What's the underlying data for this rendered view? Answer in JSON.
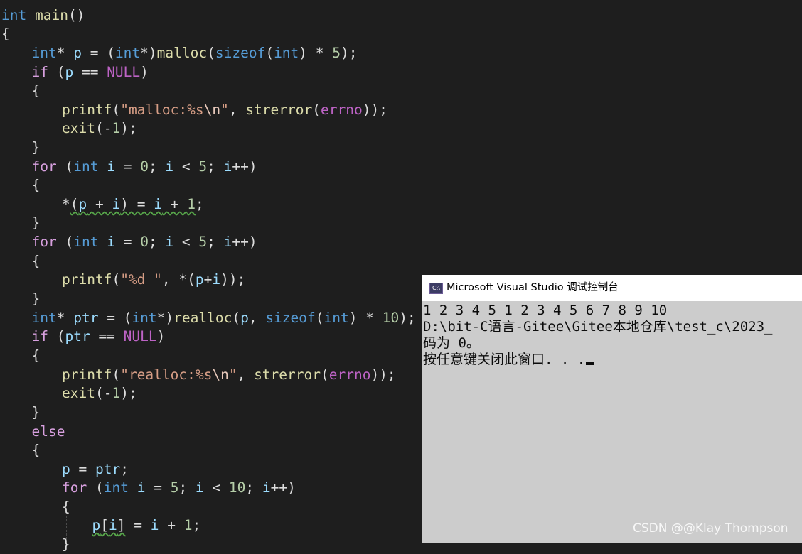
{
  "editor": {
    "lines": [
      {
        "tokens": [
          {
            "t": "int",
            "k": "kw"
          },
          {
            "t": " main",
            "k": "fn"
          },
          {
            "t": "()",
            "k": "plain"
          }
        ]
      },
      {
        "tokens": [
          {
            "t": "{",
            "k": "plain"
          }
        ]
      },
      {
        "tokens": [
          {
            "t": "int",
            "k": "kw"
          },
          {
            "t": "* ",
            "k": "plain"
          },
          {
            "t": "p",
            "k": "var"
          },
          {
            "t": " = (",
            "k": "plain"
          },
          {
            "t": "int",
            "k": "kw"
          },
          {
            "t": "*)",
            "k": "plain"
          },
          {
            "t": "malloc",
            "k": "fn"
          },
          {
            "t": "(",
            "k": "plain"
          },
          {
            "t": "sizeof",
            "k": "kw"
          },
          {
            "t": "(",
            "k": "plain"
          },
          {
            "t": "int",
            "k": "kw"
          },
          {
            "t": ") * ",
            "k": "plain"
          },
          {
            "t": "5",
            "k": "num"
          },
          {
            "t": ");",
            "k": "plain"
          }
        ]
      },
      {
        "tokens": [
          {
            "t": "if",
            "k": "ctl"
          },
          {
            "t": " (",
            "k": "plain"
          },
          {
            "t": "p",
            "k": "var"
          },
          {
            "t": " == ",
            "k": "plain"
          },
          {
            "t": "NULL",
            "k": "mac"
          },
          {
            "t": ")",
            "k": "plain"
          }
        ]
      },
      {
        "tokens": [
          {
            "t": "{",
            "k": "plain"
          }
        ]
      },
      {
        "tokens": [
          {
            "t": "printf",
            "k": "fn"
          },
          {
            "t": "(",
            "k": "plain"
          },
          {
            "t": "\"malloc:%s",
            "k": "str"
          },
          {
            "t": "\\n",
            "k": "esc"
          },
          {
            "t": "\"",
            "k": "str"
          },
          {
            "t": ", ",
            "k": "plain"
          },
          {
            "t": "strerror",
            "k": "fn"
          },
          {
            "t": "(",
            "k": "plain"
          },
          {
            "t": "errno",
            "k": "mac"
          },
          {
            "t": "));",
            "k": "plain"
          }
        ]
      },
      {
        "tokens": [
          {
            "t": "exit",
            "k": "fn"
          },
          {
            "t": "(-",
            "k": "plain"
          },
          {
            "t": "1",
            "k": "num"
          },
          {
            "t": ");",
            "k": "plain"
          }
        ]
      },
      {
        "tokens": [
          {
            "t": "}",
            "k": "plain"
          }
        ]
      },
      {
        "tokens": [
          {
            "t": "for",
            "k": "ctl"
          },
          {
            "t": " (",
            "k": "plain"
          },
          {
            "t": "int",
            "k": "kw"
          },
          {
            "t": " ",
            "k": "plain"
          },
          {
            "t": "i",
            "k": "var"
          },
          {
            "t": " = ",
            "k": "plain"
          },
          {
            "t": "0",
            "k": "num"
          },
          {
            "t": "; ",
            "k": "plain"
          },
          {
            "t": "i",
            "k": "var"
          },
          {
            "t": " < ",
            "k": "plain"
          },
          {
            "t": "5",
            "k": "num"
          },
          {
            "t": "; ",
            "k": "plain"
          },
          {
            "t": "i",
            "k": "var"
          },
          {
            "t": "++)",
            "k": "plain"
          }
        ]
      },
      {
        "tokens": [
          {
            "t": "{",
            "k": "plain"
          }
        ]
      },
      {
        "tokens": [
          {
            "t": "*",
            "k": "plain"
          },
          {
            "t": "(",
            "k": "plain",
            "w": 1
          },
          {
            "t": "p",
            "k": "var",
            "w": 1
          },
          {
            "t": " + ",
            "k": "plain",
            "w": 1
          },
          {
            "t": "i",
            "k": "var",
            "w": 1
          },
          {
            "t": ") = ",
            "k": "plain",
            "w": 1
          },
          {
            "t": "i",
            "k": "var",
            "w": 1
          },
          {
            "t": " + ",
            "k": "plain",
            "w": 1
          },
          {
            "t": "1",
            "k": "num",
            "w": 1
          },
          {
            "t": ";",
            "k": "plain"
          }
        ]
      },
      {
        "tokens": [
          {
            "t": "}",
            "k": "plain"
          }
        ]
      },
      {
        "tokens": [
          {
            "t": "for",
            "k": "ctl"
          },
          {
            "t": " (",
            "k": "plain"
          },
          {
            "t": "int",
            "k": "kw"
          },
          {
            "t": " ",
            "k": "plain"
          },
          {
            "t": "i",
            "k": "var"
          },
          {
            "t": " = ",
            "k": "plain"
          },
          {
            "t": "0",
            "k": "num"
          },
          {
            "t": "; ",
            "k": "plain"
          },
          {
            "t": "i",
            "k": "var"
          },
          {
            "t": " < ",
            "k": "plain"
          },
          {
            "t": "5",
            "k": "num"
          },
          {
            "t": "; ",
            "k": "plain"
          },
          {
            "t": "i",
            "k": "var"
          },
          {
            "t": "++)",
            "k": "plain"
          }
        ]
      },
      {
        "tokens": [
          {
            "t": "{",
            "k": "plain"
          }
        ]
      },
      {
        "tokens": [
          {
            "t": "printf",
            "k": "fn"
          },
          {
            "t": "(",
            "k": "plain"
          },
          {
            "t": "\"%d \"",
            "k": "str"
          },
          {
            "t": ", *(",
            "k": "plain"
          },
          {
            "t": "p",
            "k": "var"
          },
          {
            "t": "+",
            "k": "plain"
          },
          {
            "t": "i",
            "k": "var"
          },
          {
            "t": "));",
            "k": "plain"
          }
        ]
      },
      {
        "tokens": [
          {
            "t": "}",
            "k": "plain"
          }
        ]
      },
      {
        "tokens": [
          {
            "t": "int",
            "k": "kw"
          },
          {
            "t": "* ",
            "k": "plain"
          },
          {
            "t": "ptr",
            "k": "var"
          },
          {
            "t": " = (",
            "k": "plain"
          },
          {
            "t": "int",
            "k": "kw"
          },
          {
            "t": "*)",
            "k": "plain"
          },
          {
            "t": "realloc",
            "k": "fn"
          },
          {
            "t": "(",
            "k": "plain"
          },
          {
            "t": "p",
            "k": "var"
          },
          {
            "t": ", ",
            "k": "plain"
          },
          {
            "t": "sizeof",
            "k": "kw"
          },
          {
            "t": "(",
            "k": "plain"
          },
          {
            "t": "int",
            "k": "kw"
          },
          {
            "t": ") * ",
            "k": "plain"
          },
          {
            "t": "10",
            "k": "num"
          },
          {
            "t": ");",
            "k": "plain"
          }
        ]
      },
      {
        "tokens": [
          {
            "t": "if",
            "k": "ctl"
          },
          {
            "t": " (",
            "k": "plain"
          },
          {
            "t": "ptr",
            "k": "var"
          },
          {
            "t": " == ",
            "k": "plain"
          },
          {
            "t": "NULL",
            "k": "mac"
          },
          {
            "t": ")",
            "k": "plain"
          }
        ]
      },
      {
        "tokens": [
          {
            "t": "{",
            "k": "plain"
          }
        ]
      },
      {
        "tokens": [
          {
            "t": "printf",
            "k": "fn"
          },
          {
            "t": "(",
            "k": "plain"
          },
          {
            "t": "\"realloc:%s",
            "k": "str"
          },
          {
            "t": "\\n",
            "k": "esc"
          },
          {
            "t": "\"",
            "k": "str"
          },
          {
            "t": ", ",
            "k": "plain"
          },
          {
            "t": "strerror",
            "k": "fn"
          },
          {
            "t": "(",
            "k": "plain"
          },
          {
            "t": "errno",
            "k": "mac"
          },
          {
            "t": "));",
            "k": "plain"
          }
        ]
      },
      {
        "tokens": [
          {
            "t": "exit",
            "k": "fn"
          },
          {
            "t": "(-",
            "k": "plain"
          },
          {
            "t": "1",
            "k": "num"
          },
          {
            "t": ");",
            "k": "plain"
          }
        ]
      },
      {
        "tokens": [
          {
            "t": "}",
            "k": "plain"
          }
        ]
      },
      {
        "tokens": [
          {
            "t": "else",
            "k": "ctl"
          }
        ]
      },
      {
        "tokens": [
          {
            "t": "{",
            "k": "plain"
          }
        ]
      },
      {
        "tokens": [
          {
            "t": "p",
            "k": "var"
          },
          {
            "t": " = ",
            "k": "plain"
          },
          {
            "t": "ptr",
            "k": "var"
          },
          {
            "t": ";",
            "k": "plain"
          }
        ]
      },
      {
        "tokens": [
          {
            "t": "for",
            "k": "ctl"
          },
          {
            "t": " (",
            "k": "plain"
          },
          {
            "t": "int",
            "k": "kw"
          },
          {
            "t": " ",
            "k": "plain"
          },
          {
            "t": "i",
            "k": "var"
          },
          {
            "t": " = ",
            "k": "plain"
          },
          {
            "t": "5",
            "k": "num"
          },
          {
            "t": "; ",
            "k": "plain"
          },
          {
            "t": "i",
            "k": "var"
          },
          {
            "t": " < ",
            "k": "plain"
          },
          {
            "t": "10",
            "k": "num"
          },
          {
            "t": "; ",
            "k": "plain"
          },
          {
            "t": "i",
            "k": "var"
          },
          {
            "t": "++)",
            "k": "plain"
          }
        ]
      },
      {
        "tokens": [
          {
            "t": "{",
            "k": "plain"
          }
        ]
      },
      {
        "tokens": [
          {
            "t": "p",
            "k": "var",
            "w": 1
          },
          {
            "t": "[",
            "k": "plain",
            "w": 1
          },
          {
            "t": "i",
            "k": "var",
            "w": 1
          },
          {
            "t": "]",
            "k": "plain",
            "w": 1
          },
          {
            "t": " = ",
            "k": "plain"
          },
          {
            "t": "i",
            "k": "var"
          },
          {
            "t": " + ",
            "k": "plain"
          },
          {
            "t": "1",
            "k": "num"
          },
          {
            "t": ";",
            "k": "plain"
          }
        ]
      },
      {
        "tokens": [
          {
            "t": "}",
            "k": "plain"
          }
        ]
      }
    ]
  },
  "console": {
    "icon_text": "C:\\",
    "title": "Microsoft Visual Studio 调试控制台",
    "lines": [
      "1 2 3 4 5 1 2 3 4 5 6 7 8 9 10",
      "D:\\bit-C语言-Gitee\\Gitee本地仓库\\test_c\\2023_",
      "码为 0。",
      "按任意键关闭此窗口. . ."
    ]
  },
  "watermark": "CSDN @@Klay Thompson",
  "colors": {
    "editor_bg": "#1e1e1e",
    "keyword": "#569cd6",
    "control": "#d8a0df",
    "function": "#dcdcaa",
    "variable": "#9cdcfe",
    "string": "#d69d85",
    "number": "#b5cea8",
    "macro": "#bd63c5",
    "console_bg": "#cccccc"
  }
}
